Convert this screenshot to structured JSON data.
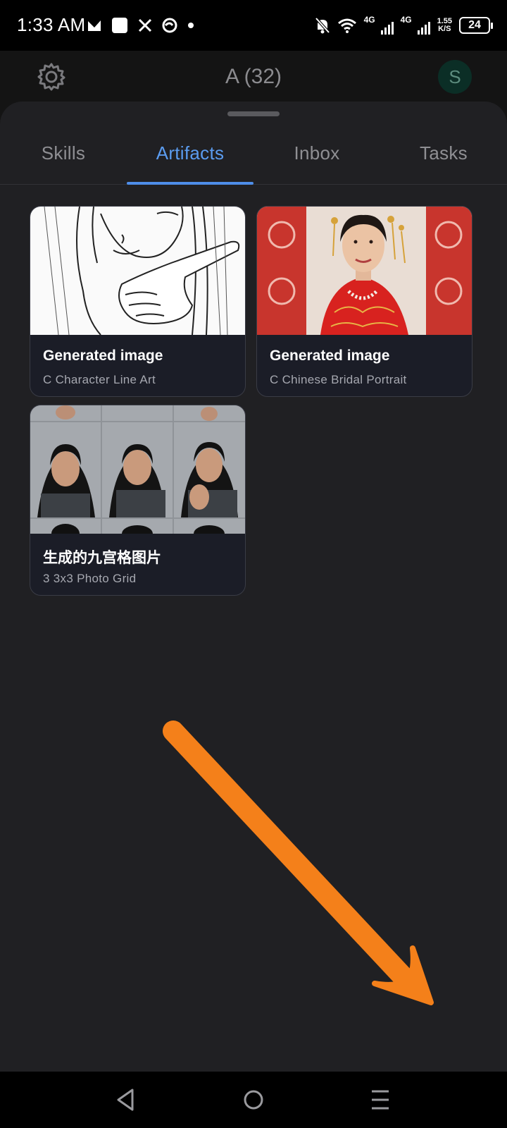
{
  "status_bar": {
    "time": "1:33 AM",
    "network_1": "4G",
    "network_2": "4G",
    "speed_value": "1.55",
    "speed_unit": "K/S",
    "battery": "24",
    "icons": [
      "gallery-icon",
      "square-app-icon",
      "x-icon",
      "chat-bubble-icon",
      "dot-icon",
      "mute-bell-icon",
      "wifi-icon",
      "signal-icon",
      "battery-icon"
    ]
  },
  "header": {
    "title": "A (32)",
    "avatar_letter": "S"
  },
  "tabs": [
    {
      "label": "Skills",
      "active": false
    },
    {
      "label": "Artifacts",
      "active": true
    },
    {
      "label": "Inbox",
      "active": false
    },
    {
      "label": "Tasks",
      "active": false
    }
  ],
  "artifacts": [
    {
      "title": "Generated image",
      "subtitle": "C Character Line Art",
      "thumb": "line-art-woman-pointing"
    },
    {
      "title": "Generated image",
      "subtitle": "C Chinese Bridal Portrait",
      "thumb": "chinese-bride-red-dress"
    },
    {
      "title": "生成的九宫格图片",
      "subtitle": "3 3x3 Photo Grid",
      "thumb": "portrait-grid"
    }
  ],
  "overlay": {
    "arrow_color": "#F4801A"
  },
  "colors": {
    "accent": "#4E8EE9",
    "sheet": "#202023",
    "card": "#1B1D27"
  },
  "nav": [
    "back-icon",
    "home-icon",
    "menu-icon"
  ]
}
